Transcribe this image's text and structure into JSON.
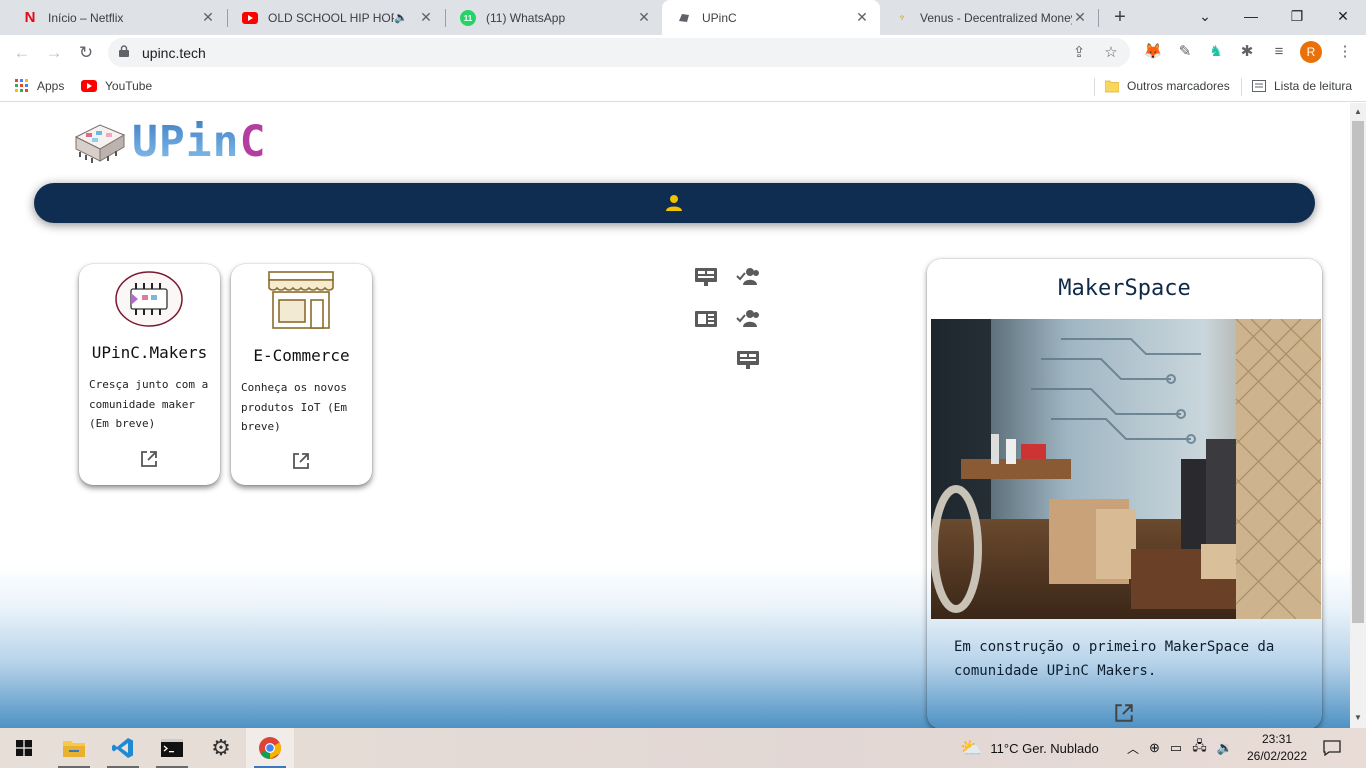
{
  "browser": {
    "tabs": [
      {
        "title": "Início – Netflix",
        "icon": "netflix-icon",
        "active": false
      },
      {
        "title": "OLD SCHOOL HIP HOP M",
        "icon": "youtube-icon",
        "active": false,
        "audio": true
      },
      {
        "title": "(11) WhatsApp",
        "icon": "whatsapp-icon",
        "badge": "11",
        "active": false
      },
      {
        "title": "UPinC",
        "icon": "upinc-icon",
        "active": true
      },
      {
        "title": "Venus - Decentralized Money",
        "icon": "venus-icon",
        "active": false
      }
    ],
    "new_tab": "+",
    "url": "upinc.tech",
    "profile_initial": "R",
    "bookmarks": [
      {
        "label": "Apps",
        "icon": "apps-grid-icon"
      },
      {
        "label": "YouTube",
        "icon": "youtube-icon"
      }
    ],
    "other_bookmarks": "Outros marcadores",
    "reading_list": "Lista de leitura"
  },
  "site": {
    "logo_text": "UPin",
    "logo_c": "C",
    "cards": [
      {
        "title": "UPinC.Makers",
        "description": "Cresça junto com a comunidade maker (Em breve)",
        "icon": "chip-circle-icon"
      },
      {
        "title": "E-Commerce",
        "description": "Conheça os novos produtos IoT (Em breve)",
        "icon": "storefront-icon"
      }
    ],
    "makerspace": {
      "title": "MakerSpace",
      "description": "Em construção o primeiro MakerSpace da comunidade UPinC Makers.",
      "photo": "makerspace-room-photo"
    }
  },
  "taskbar": {
    "weather": "11°C  Ger. Nublado",
    "time": "23:31",
    "date": "26/02/2022"
  },
  "colors": {
    "navbar": "#0f2d50",
    "user_icon": "#f2c200",
    "accent_blue": "#3d7fc4"
  }
}
